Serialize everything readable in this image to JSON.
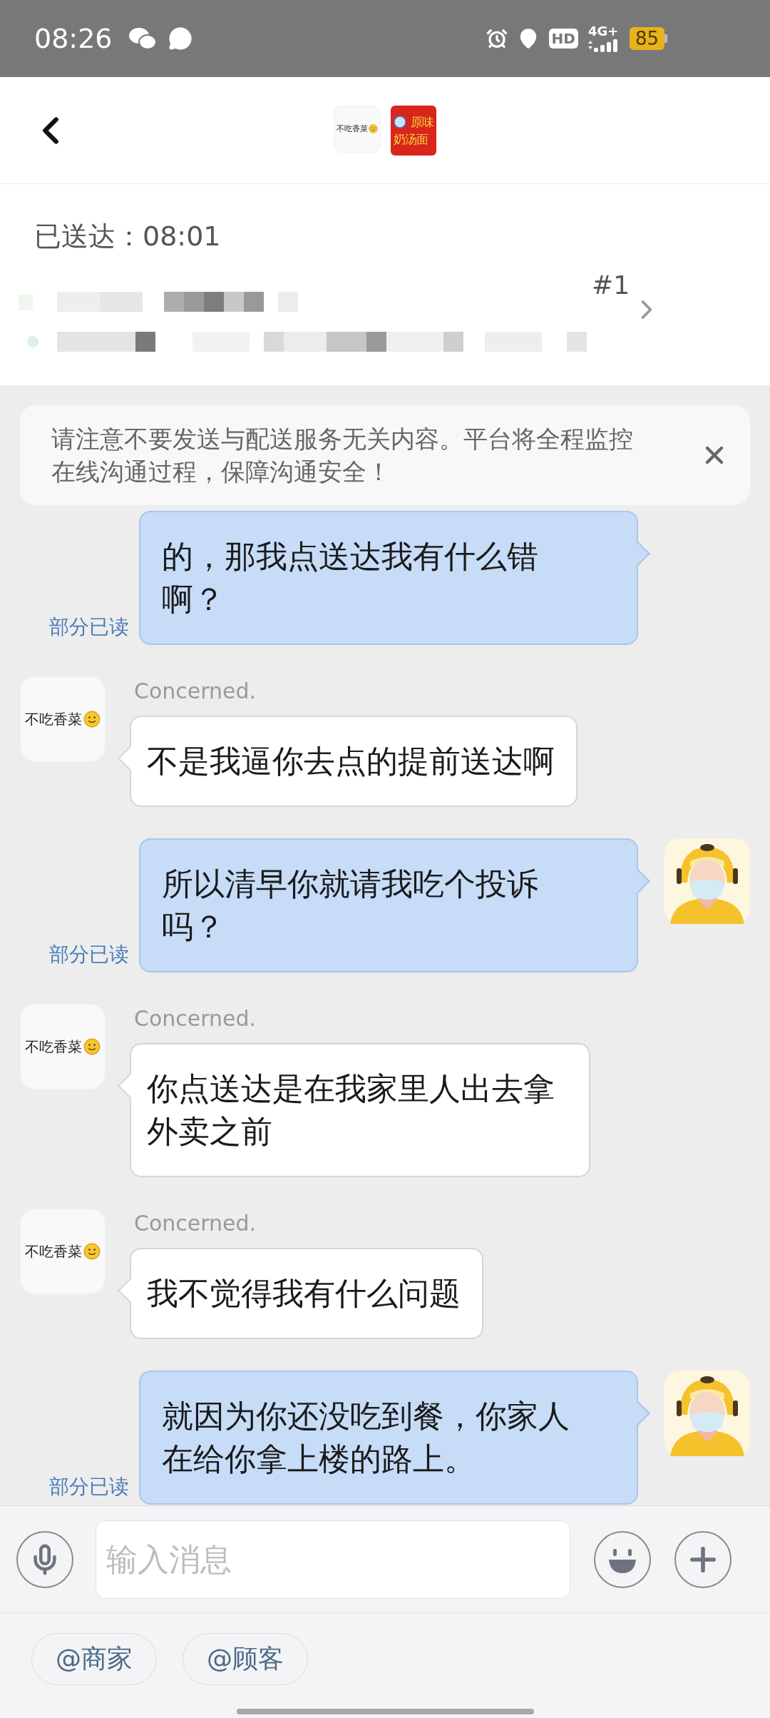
{
  "status_bar": {
    "time": "08:26",
    "hd": "HD",
    "network": "4G+",
    "battery": "85"
  },
  "header": {
    "customer_avatar": "不吃香菜",
    "shop_logo": [
      "原味",
      "奶汤面"
    ]
  },
  "order": {
    "status": "已送达：08:01",
    "number": "#1"
  },
  "notice": {
    "text": "请注意不要发送与配送服务无关内容。平台将全程监控在线沟通过程，保障沟通安全！"
  },
  "messages": [
    {
      "kind": "sent",
      "text": "的，那我点送达我有什么错啊？",
      "read": "部分已读",
      "avatar": false
    },
    {
      "kind": "received",
      "sender": "Concerned.",
      "avatar": "不吃香菜",
      "text": "不是我逼你去点的提前送达啊"
    },
    {
      "kind": "sent",
      "text": "所以清早你就请我吃个投诉吗？",
      "read": "部分已读",
      "avatar": true
    },
    {
      "kind": "received",
      "sender": "Concerned.",
      "avatar": "不吃香菜",
      "text": "你点送达是在我家里人出去拿外卖之前"
    },
    {
      "kind": "received",
      "sender": "Concerned.",
      "avatar": "不吃香菜",
      "text": "我不觉得我有什么问题"
    },
    {
      "kind": "sent",
      "text": "就因为你还没吃到餐，你家人在给你拿上楼的路上。",
      "read": "部分已读",
      "avatar": true
    }
  ],
  "input": {
    "placeholder": "输入消息"
  },
  "quick_replies": [
    "@商家",
    "@顾客"
  ]
}
